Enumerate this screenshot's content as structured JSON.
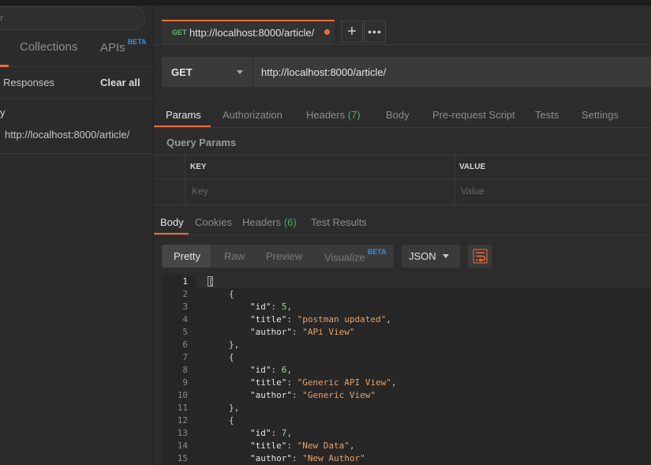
{
  "sidebar": {
    "search_placeholder": "r",
    "tabs": [
      "Collections",
      "APIs"
    ],
    "apis_badge": "BETA",
    "responses_label": "Responses",
    "clear_all": "Clear all",
    "today_label": "y",
    "history_url": "http://localhost:8000/article/"
  },
  "request_tab": {
    "method": "GET",
    "url": "http://localhost:8000/article/",
    "add": "+",
    "more": "•••"
  },
  "request": {
    "method": "GET",
    "url": "http://localhost:8000/article/"
  },
  "request_tabs": {
    "params": "Params",
    "authorization": "Authorization",
    "headers": "Headers",
    "headers_count": "(7)",
    "body": "Body",
    "prerequest": "Pre-request Script",
    "tests": "Tests",
    "settings": "Settings"
  },
  "query_params": {
    "label": "Query Params",
    "key_header": "KEY",
    "value_header": "VALUE",
    "key_placeholder": "Key",
    "value_placeholder": "Value"
  },
  "response_tabs": {
    "body": "Body",
    "cookies": "Cookies",
    "headers": "Headers",
    "headers_count": "(6)",
    "test_results": "Test Results"
  },
  "view": {
    "pretty": "Pretty",
    "raw": "Raw",
    "preview": "Preview",
    "visualize": "Visualize",
    "visualize_badge": "BETA",
    "format": "JSON"
  },
  "code_lines": [
    {
      "n": "1"
    },
    {
      "n": "2"
    },
    {
      "n": "3"
    },
    {
      "n": "4"
    },
    {
      "n": "5"
    },
    {
      "n": "6"
    },
    {
      "n": "7"
    },
    {
      "n": "8"
    },
    {
      "n": "9"
    },
    {
      "n": "10"
    },
    {
      "n": "11"
    },
    {
      "n": "12"
    },
    {
      "n": "13"
    },
    {
      "n": "14"
    },
    {
      "n": "15"
    }
  ],
  "code": {
    "l1": "[",
    "l2": "{",
    "k_id": "\"id\"",
    "k_title": "\"title\"",
    "k_author": "\"author\"",
    "v1_id": "5",
    "v1_title": "\"postman updated\"",
    "v1_author": "\"APi View\"",
    "v2_id": "6",
    "v2_title": "\"Generic API View\"",
    "v2_author": "\"Generic View\"",
    "v3_id": "7",
    "v3_title": "\"New Data\"",
    "v3_author": "\"New Author\"",
    "close_obj": "},",
    "open_obj": "{"
  },
  "colors": {
    "accent": "#f26b3a",
    "method_green": "#6cb36c",
    "string": "#e89f67",
    "number": "#a6d7a6",
    "beta": "#3b8fd9"
  }
}
